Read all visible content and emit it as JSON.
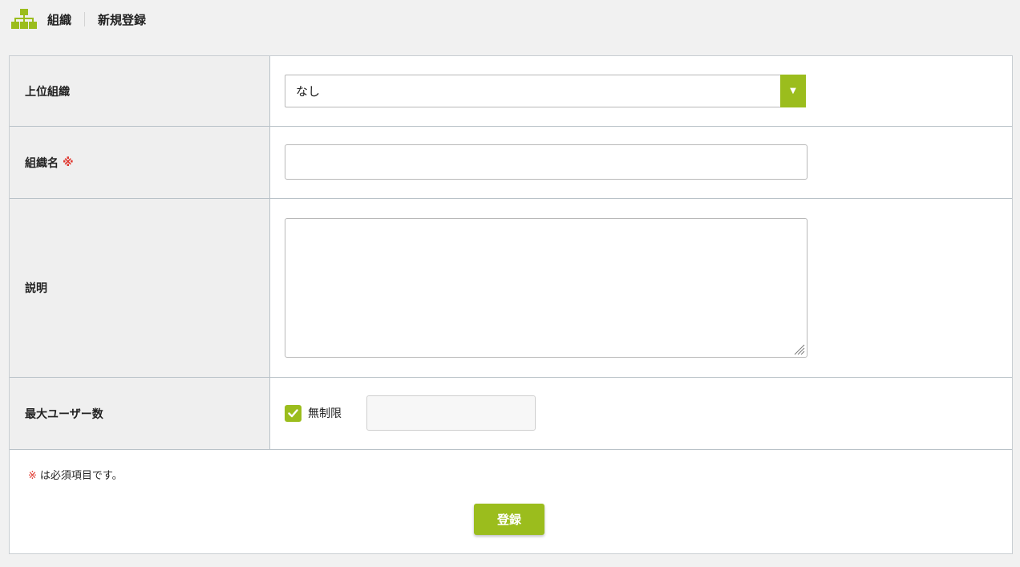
{
  "header": {
    "section": "組織",
    "page": "新規登録",
    "icon": "org-chart-icon"
  },
  "form": {
    "parent_org": {
      "label": "上位組織",
      "value": "なし"
    },
    "org_name": {
      "label": "組織名",
      "required_mark": "※",
      "value": ""
    },
    "description": {
      "label": "説明",
      "value": ""
    },
    "max_users": {
      "label": "最大ユーザー数",
      "unlimited_label": "無制限",
      "unlimited_checked": true,
      "value": ""
    }
  },
  "footer": {
    "note_mark": "※",
    "note_text": "は必須項目です。",
    "submit_label": "登録"
  },
  "colors": {
    "accent": "#9bbd1d",
    "required": "#e0382f",
    "label_bg": "#efefef"
  }
}
